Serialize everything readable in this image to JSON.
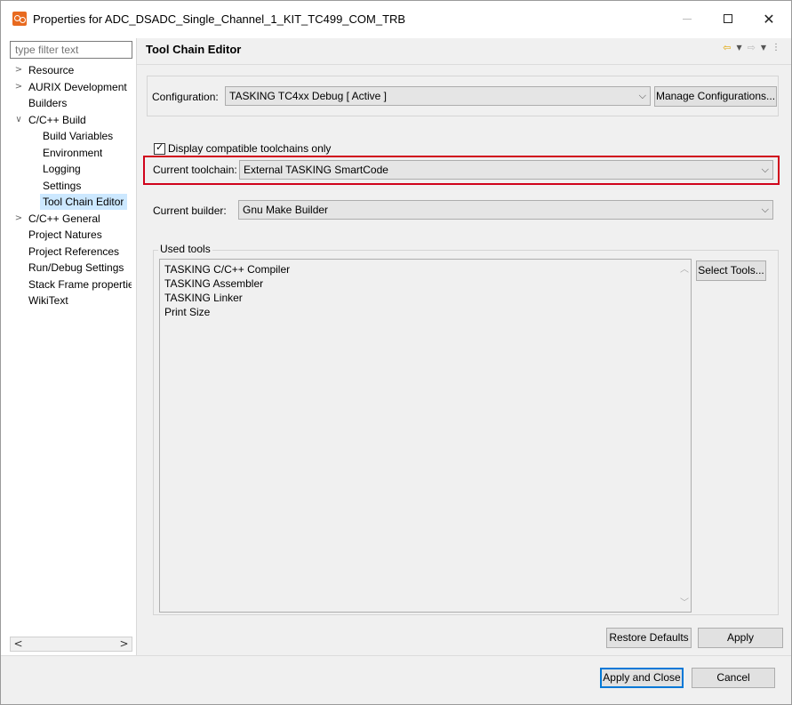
{
  "window": {
    "title": "Properties for ADC_DSADC_Single_Channel_1_KIT_TC499_COM_TRB"
  },
  "sidebar": {
    "filter_placeholder": "type filter text",
    "items": [
      {
        "label": "Resource",
        "level": 0,
        "expander": "collapsed"
      },
      {
        "label": "AURIX Development",
        "level": 0,
        "expander": "collapsed"
      },
      {
        "label": "Builders",
        "level": 0,
        "expander": "none"
      },
      {
        "label": "C/C++ Build",
        "level": 0,
        "expander": "expanded"
      },
      {
        "label": "Build Variables",
        "level": 1,
        "expander": "none"
      },
      {
        "label": "Environment",
        "level": 1,
        "expander": "none"
      },
      {
        "label": "Logging",
        "level": 1,
        "expander": "none"
      },
      {
        "label": "Settings",
        "level": 1,
        "expander": "none"
      },
      {
        "label": "Tool Chain Editor",
        "level": 1,
        "expander": "none",
        "selected": true
      },
      {
        "label": "C/C++ General",
        "level": 0,
        "expander": "collapsed"
      },
      {
        "label": "Project Natures",
        "level": 0,
        "expander": "none"
      },
      {
        "label": "Project References",
        "level": 0,
        "expander": "none"
      },
      {
        "label": "Run/Debug Settings",
        "level": 0,
        "expander": "none"
      },
      {
        "label": "Stack Frame properties",
        "level": 0,
        "expander": "none"
      },
      {
        "label": "WikiText",
        "level": 0,
        "expander": "none"
      }
    ]
  },
  "main": {
    "title": "Tool Chain Editor",
    "configuration": {
      "label": "Configuration:",
      "value": "TASKING TC4xx Debug  [ Active ]",
      "manage_button": "Manage Configurations..."
    },
    "display_compatible": {
      "label": "Display compatible toolchains only",
      "checked": true
    },
    "current_toolchain": {
      "label": "Current toolchain:",
      "value": "External TASKING SmartCode"
    },
    "current_builder": {
      "label": "Current builder:",
      "value": "Gnu Make Builder"
    },
    "used_tools": {
      "label": "Used tools",
      "items": [
        "TASKING C/C++ Compiler",
        "TASKING Assembler",
        "TASKING Linker",
        "Print Size"
      ],
      "select_button": "Select Tools..."
    },
    "restore_defaults_button": "Restore Defaults",
    "apply_button": "Apply"
  },
  "footer": {
    "apply_and_close_button": "Apply and Close",
    "cancel_button": "Cancel"
  },
  "colors": {
    "selection": "#cce8ff",
    "highlight_border": "#d0021b",
    "app_icon": "#e86a1f",
    "nav_back_arrow": "#e0a500"
  }
}
